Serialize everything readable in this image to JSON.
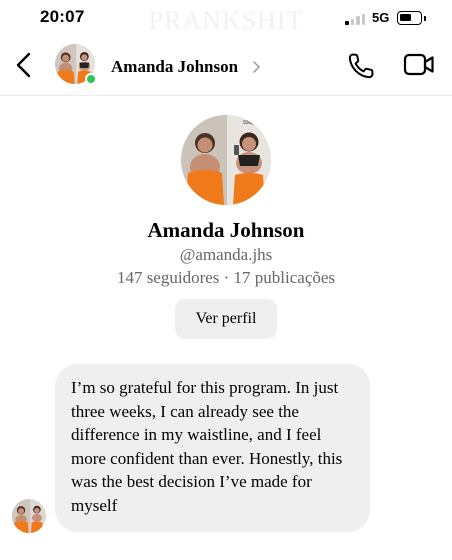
{
  "status_bar": {
    "time": "20:07",
    "watermark": "PRANKSHIT",
    "network": "5G",
    "signal_bars_active": 1,
    "signal_bars_total": 4
  },
  "header": {
    "back_icon": "chevron-left-icon",
    "contact_name": "Amanda Johnson",
    "online": true,
    "call_icon": "phone-icon",
    "video_icon": "video-camera-icon"
  },
  "profile": {
    "name": "Amanda Johnson",
    "handle": "@amanda.jhs",
    "stats": "147 seguidores · 17 publicações",
    "view_profile_label": "Ver perfil",
    "photo_caption": "93kg"
  },
  "message": {
    "text": "I’m so grateful for this program. In just three weeks, I can already see the difference in my waistline, and I feel more confident than ever. Honestly, this was the best decision I’ve made for myself"
  },
  "colors": {
    "online_green": "#2dc653",
    "bubble_bg": "#efefef",
    "button_bg": "#efefef",
    "secondary_text": "#666666",
    "outfit_orange": "#f07a1a"
  }
}
